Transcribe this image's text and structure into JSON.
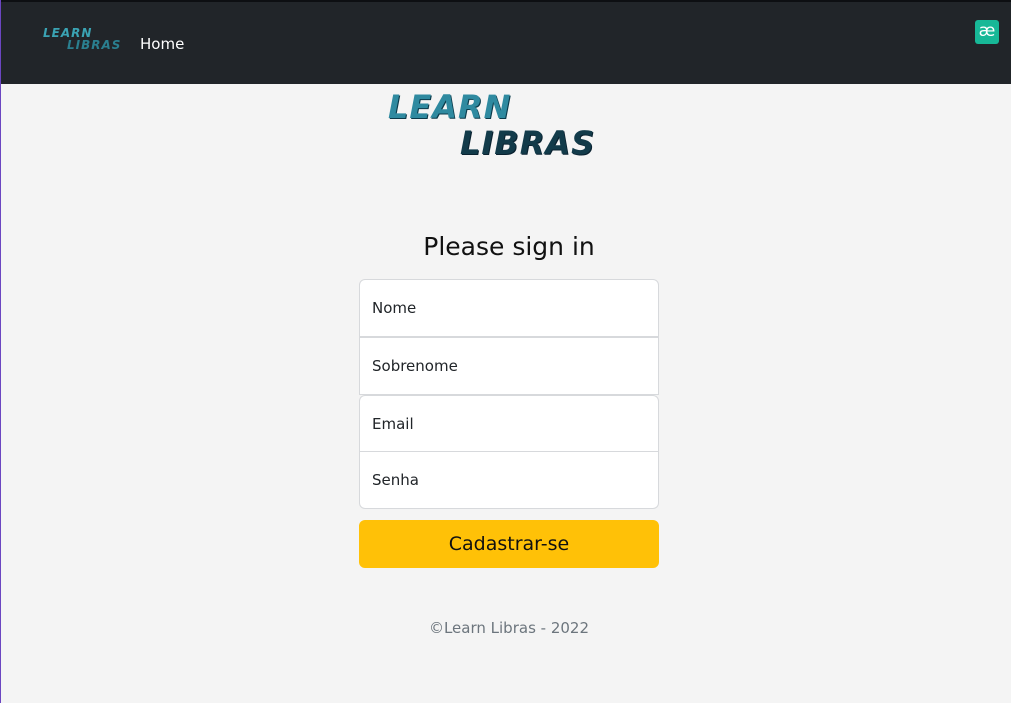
{
  "nav": {
    "logo_line1": "LEARN",
    "logo_line2": "LIBRAS",
    "home_label": "Home",
    "extension_icon": "ae-extension-icon",
    "extension_glyph": "æ"
  },
  "hero": {
    "logo_line1": "LEARN",
    "logo_line2": "LIBRAS"
  },
  "form": {
    "title": "Please sign in",
    "nome_placeholder": "Nome",
    "sobrenome_placeholder": "Sobrenome",
    "email_placeholder": "Email",
    "senha_placeholder": "Senha",
    "submit_label": "Cadastrar-se"
  },
  "footer": {
    "text": "©Learn Libras - 2022"
  },
  "colors": {
    "navbar": "#212529",
    "background": "#f4f4f4",
    "button": "#ffc107",
    "extension": "#17b897"
  }
}
